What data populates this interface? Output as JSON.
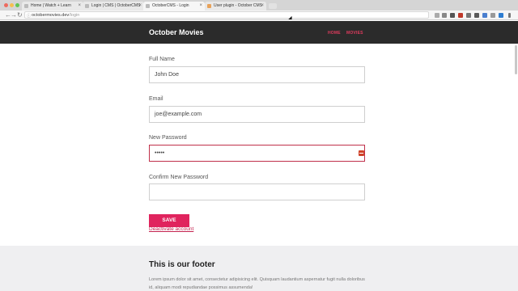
{
  "browser": {
    "tabs": [
      {
        "title": "Home | Watch + Learn"
      },
      {
        "title": "Login | CMS | OctoberCMS"
      },
      {
        "title": "OctoberCMS - Login"
      },
      {
        "title": "User plugin - October CMS"
      }
    ],
    "url": {
      "host": "octobermovies.dev",
      "path": "/login"
    }
  },
  "header": {
    "brand": "October Movies",
    "nav": [
      {
        "label": "HOME"
      },
      {
        "label": "MOVIES"
      }
    ]
  },
  "form": {
    "full_name": {
      "label": "Full Name",
      "value": "John Doe"
    },
    "email": {
      "label": "Email",
      "value": "joe@example.com"
    },
    "new_password": {
      "label": "New Password",
      "value": "•••••"
    },
    "confirm_password": {
      "label": "Confirm New Password",
      "value": ""
    },
    "save_label": "SAVE",
    "deactivate_label": "Deactivate account"
  },
  "footer": {
    "title": "This is our footer",
    "text": "Lorem ipsum dolor sit amet, consectetur adipisicing elit. Quisquam laudantium aspernatur fugit nulla doloribus id, aliquam modi repudiandae possimus assumenda!"
  },
  "colors": {
    "header_bg": "#2b2b2b",
    "accent": "#e0245e",
    "footer_bg": "#efeff1"
  }
}
